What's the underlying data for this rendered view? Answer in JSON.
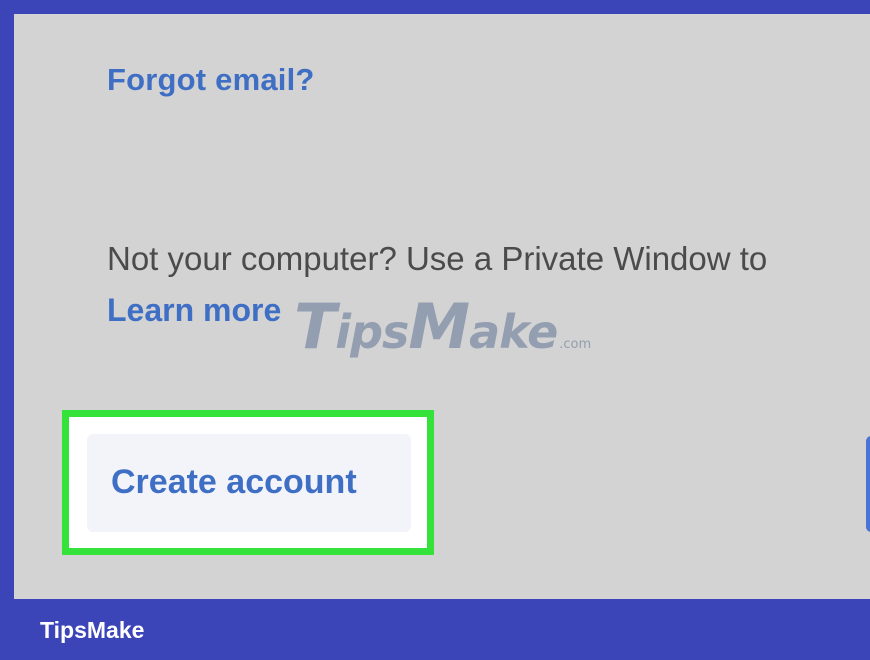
{
  "signin": {
    "forgot_email_link": "Forgot email?",
    "privacy_notice": "Not your computer? Use a Private Window to",
    "learn_more_link": "Learn more",
    "create_account_button": "Create account"
  },
  "watermark": {
    "big_t": "T",
    "ips": "ips",
    "big_m": "M",
    "ake": "ake",
    "tld": ".com"
  },
  "footer": {
    "brand": "TipsMake"
  },
  "colors": {
    "frame": "#3c45b8",
    "screen_background": "#d3d3d3",
    "link_blue": "#3f6fc4",
    "highlight_green": "#35e23a",
    "body_text": "#4b4b4b"
  }
}
